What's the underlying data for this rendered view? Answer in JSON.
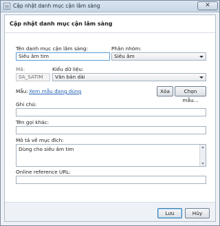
{
  "window": {
    "title": "Cập nhật danh mục cận lâm sàng",
    "close_glyph": "✕"
  },
  "header": {
    "title": "Cập nhật danh mục cận lâm sàng"
  },
  "form": {
    "name_label": "Tên danh mục cận lâm sàng:",
    "name_value": "Siêu âm tim",
    "group_label": "Phân nhóm:",
    "group_value": "Siêu âm",
    "code_label": "Mã:",
    "code_value": "0A_SATIM",
    "datatype_label": "Kiểu dữ liệu:",
    "datatype_value": "Văn bản dài",
    "template_label": "Mẫu:",
    "template_link": "Xem mẫu đang dùng",
    "delete_button": "Xóa",
    "choose_template_button": "Chọn mẫu...",
    "note_label": "Ghi chú:",
    "note_value": "",
    "alias_label": "Tên gọi khác:",
    "alias_value": "",
    "purpose_label": "Mô tả về mục đích:",
    "purpose_value": "Dùng cho siêu âm tim",
    "url_label": "Online reference URL:",
    "url_value": ""
  },
  "footer": {
    "save_button": "Lưu",
    "cancel_button": "Hủy"
  }
}
